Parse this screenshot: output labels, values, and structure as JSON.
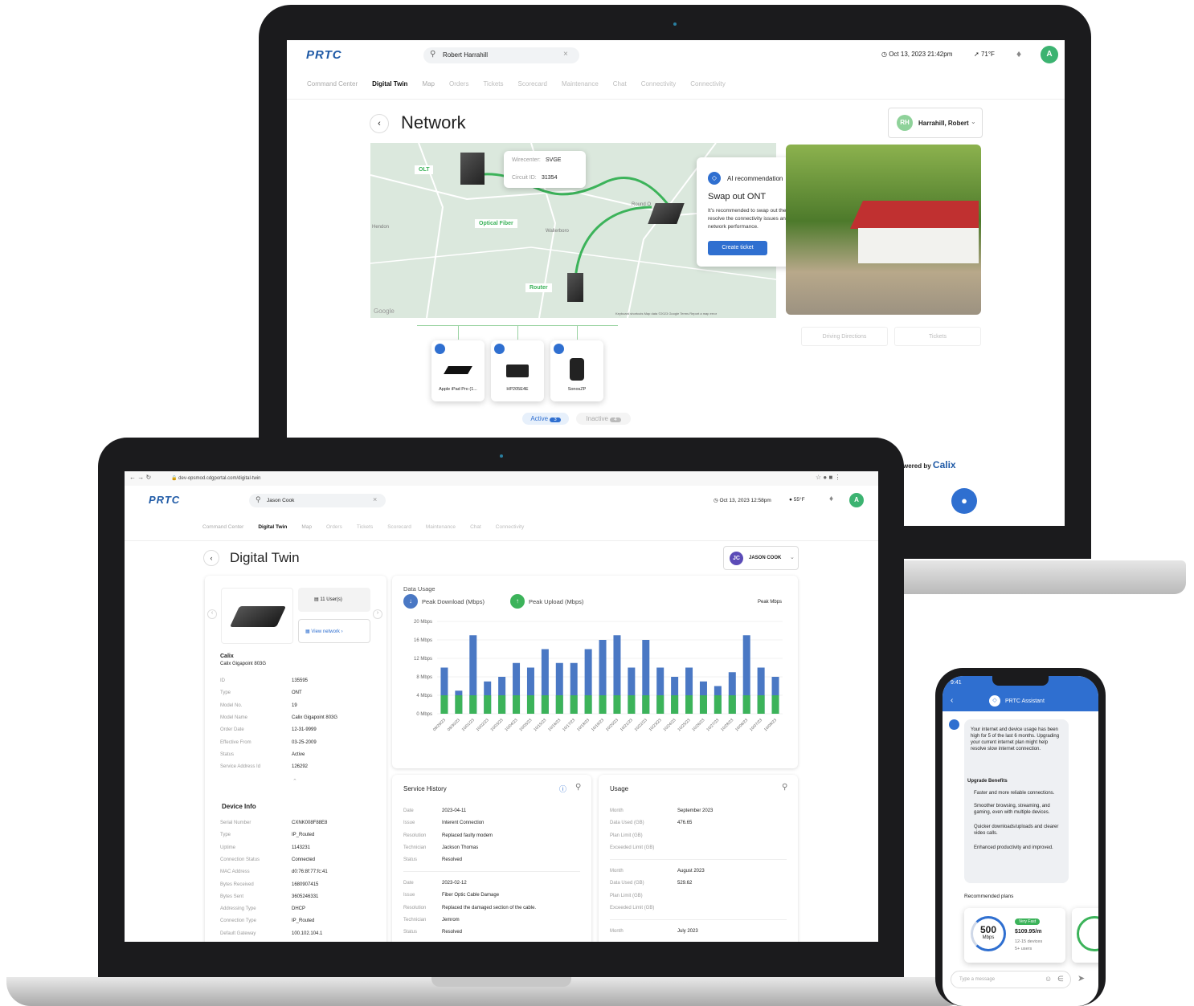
{
  "back": {
    "logo": "PRTC",
    "search_value": "Robert Harrahill",
    "datetime": "Oct 13, 2023 21:42pm",
    "temperature": "71°F",
    "avatar": "A",
    "nav": [
      "Command Center",
      "Digital Twin",
      "Map",
      "Orders",
      "Tickets",
      "Scorecard",
      "Maintenance",
      "Chat",
      "Connectivity",
      "Connectivity"
    ],
    "page_title": "Network",
    "user_initials": "RH",
    "user_name": "Harrahill, Robert",
    "wirecenter_label": "Wirecenter:",
    "wirecenter_value": "SVGE",
    "circuit_label": "Circuit ID:",
    "circuit_value": "31354",
    "map_labels": {
      "olt": "OLT",
      "fiber": "Optical Fiber",
      "router": "Router",
      "town1": "Wallerboro",
      "town2": "Round O",
      "town3": "Hendon",
      "google": "Google",
      "footer": "Keyboard shortcuts   Map data ©2023 Google   Terms   Report a map error"
    },
    "ai": {
      "title": "AI recommendation",
      "heading": "Swap out ONT",
      "body": "It's recommended to swap out the ONT with a new unit to resolve the connectivity issues and ensure seamless network performance.",
      "button": "Create ticket"
    },
    "actions": [
      "Driving Directions",
      "Tickets"
    ],
    "devices": [
      "Apple iPad Pro (1...",
      "HP205E4E",
      "SonosZP"
    ],
    "active_label": "Active",
    "active_count": "3",
    "inactive_label": "Inactive",
    "inactive_count": "4",
    "powered_by": "wered by",
    "calix": "Calix"
  },
  "front": {
    "url": "dev-opsmod.cdgportal.com/digital-twin",
    "logo": "PRTC",
    "search_value": "Jason Cook",
    "datetime": "Oct 13, 2023 12:58pm",
    "temperature": "55°F",
    "avatar": "A",
    "nav": [
      "Command Center",
      "Digital Twin",
      "Map",
      "Orders",
      "Tickets",
      "Scorecard",
      "Maintenance",
      "Chat",
      "Connectivity"
    ],
    "page_title": "Digital Twin",
    "user_initials": "JC",
    "user_name": "JASON COOK",
    "users": "11 User(s)",
    "view_network": "View network",
    "device_brand": "Calix",
    "device_model": "Calix Gigapoint 803G",
    "device_fields": [
      {
        "k": "ID",
        "v": "135595"
      },
      {
        "k": "Type",
        "v": "ONT"
      },
      {
        "k": "Model No.",
        "v": "19"
      },
      {
        "k": "Model Name",
        "v": "Calix Gigapoint 803G"
      },
      {
        "k": "Order Date",
        "v": "12-31-9999"
      },
      {
        "k": "Effective From",
        "v": "03-25-2009"
      },
      {
        "k": "Status",
        "v": "Active"
      },
      {
        "k": "Service Address Id",
        "v": "126292"
      }
    ],
    "device_info_title": "Device Info",
    "device_info": [
      {
        "k": "Serial Number",
        "v": "CXNK008F88E8"
      },
      {
        "k": "Type",
        "v": "IP_Routed"
      },
      {
        "k": "Uptime",
        "v": "1143231"
      },
      {
        "k": "Connection Status",
        "v": "Connected"
      },
      {
        "k": "MAC Address",
        "v": "d0:76:8f:77:fc:41"
      },
      {
        "k": "Bytes Received",
        "v": "1680907415"
      },
      {
        "k": "Bytes Sent",
        "v": "3605246331"
      },
      {
        "k": "Addressing Type",
        "v": "DHCP"
      },
      {
        "k": "Connection Type",
        "v": "IP_Routed"
      },
      {
        "k": "Default Gateway",
        "v": "100.102.104.1"
      }
    ],
    "service_history_title": "Service History",
    "service_history": [
      [
        {
          "k": "Date",
          "v": "2023-04-11"
        },
        {
          "k": "Issue",
          "v": "Interent Connection"
        },
        {
          "k": "Resolution",
          "v": "Replaced faulty modem"
        },
        {
          "k": "Technician",
          "v": "Jackson Thomas"
        },
        {
          "k": "Status",
          "v": "Resolved"
        }
      ],
      [
        {
          "k": "Date",
          "v": "2023-02-12"
        },
        {
          "k": "Issue",
          "v": "Fiber Optic Cable Damage"
        },
        {
          "k": "Resolution",
          "v": "Replaced the damaged section of the cable."
        },
        {
          "k": "Technician",
          "v": "Jemrom"
        },
        {
          "k": "Status",
          "v": "Resolved"
        }
      ]
    ],
    "usage_title": "Usage",
    "usage": [
      [
        {
          "k": "Month",
          "v": "September 2023"
        },
        {
          "k": "Data Used (GB)",
          "v": "476.65"
        },
        {
          "k": "Plan Limit (GB)",
          "v": ""
        },
        {
          "k": "Exceeded Limit (GB)",
          "v": ""
        }
      ],
      [
        {
          "k": "Month",
          "v": "August 2023"
        },
        {
          "k": "Data Used (GB)",
          "v": "529.62"
        },
        {
          "k": "Plan Limit (GB)",
          "v": ""
        },
        {
          "k": "Exceeded Limit (GB)",
          "v": ""
        }
      ],
      [
        {
          "k": "Month",
          "v": "July 2023"
        }
      ]
    ]
  },
  "chart_data": {
    "type": "bar",
    "title": "Data Usage",
    "ylabel": "",
    "corner_label": "Peak Mbps",
    "ylim": [
      0,
      20
    ],
    "yticks": [
      "20 Mbps",
      "16 Mbps",
      "12 Mbps",
      "8 Mbps",
      "4 Mbps",
      "0 Mbps"
    ],
    "categories": [
      "09/29/23",
      "09/30/23",
      "10/01/23",
      "10/02/23",
      "10/03/23",
      "10/04/23",
      "10/05/23",
      "10/15/23",
      "10/16/23",
      "10/17/23",
      "10/18/23",
      "10/19/23",
      "10/20/23",
      "10/21/23",
      "10/22/23",
      "10/23/23",
      "10/24/23",
      "10/25/23",
      "10/26/23",
      "10/27/23",
      "10/28/23",
      "10/06/23",
      "10/07/23",
      "10/08/23",
      "10/09/23",
      "10/10/23"
    ],
    "series": [
      {
        "name": "Peak Download (Mbps)",
        "color": "#4a78c4",
        "values": [
          10,
          5,
          17,
          7,
          8,
          11,
          10,
          14,
          11,
          11,
          14,
          16,
          17,
          10,
          16,
          10,
          8,
          10,
          7,
          6,
          9,
          17,
          10,
          8
        ]
      },
      {
        "name": "Peak Upload (Mbps)",
        "color": "#3cb35a",
        "values": [
          4,
          4,
          4,
          4,
          4,
          4,
          4,
          4,
          4,
          4,
          4,
          4,
          4,
          4,
          4,
          4,
          4,
          4,
          4,
          4,
          4,
          4,
          4,
          4
        ]
      }
    ]
  },
  "phone": {
    "time": "9:41",
    "assistant": "PRTC Assistant",
    "message": "Your internet and device usage has been high for 5 of the last 6 months. Upgrading your current internet plan might help resolve slow internet connection.",
    "benefits_title": "Upgrade Benefits",
    "benefits": [
      "Faster and more reliable connections.",
      "Smoother browsing, streaming, and gaming, even with multiple devices.",
      "Quicker downloads/uploads and clearer video calls.",
      "Enhanced productivity and improved."
    ],
    "recommended": "Recommended plans",
    "plan_speed": "500",
    "plan_unit": "Mbps",
    "plan_badge": "Very Fast",
    "plan_price": "$109.95/m",
    "plan_devices": "12-15 devices",
    "plan_users": "5+ users",
    "input_placeholder": "Type a message"
  },
  "colors": {
    "brand": "#1f5aa6",
    "green": "#3cb371",
    "blue": "#2f6fd0"
  }
}
